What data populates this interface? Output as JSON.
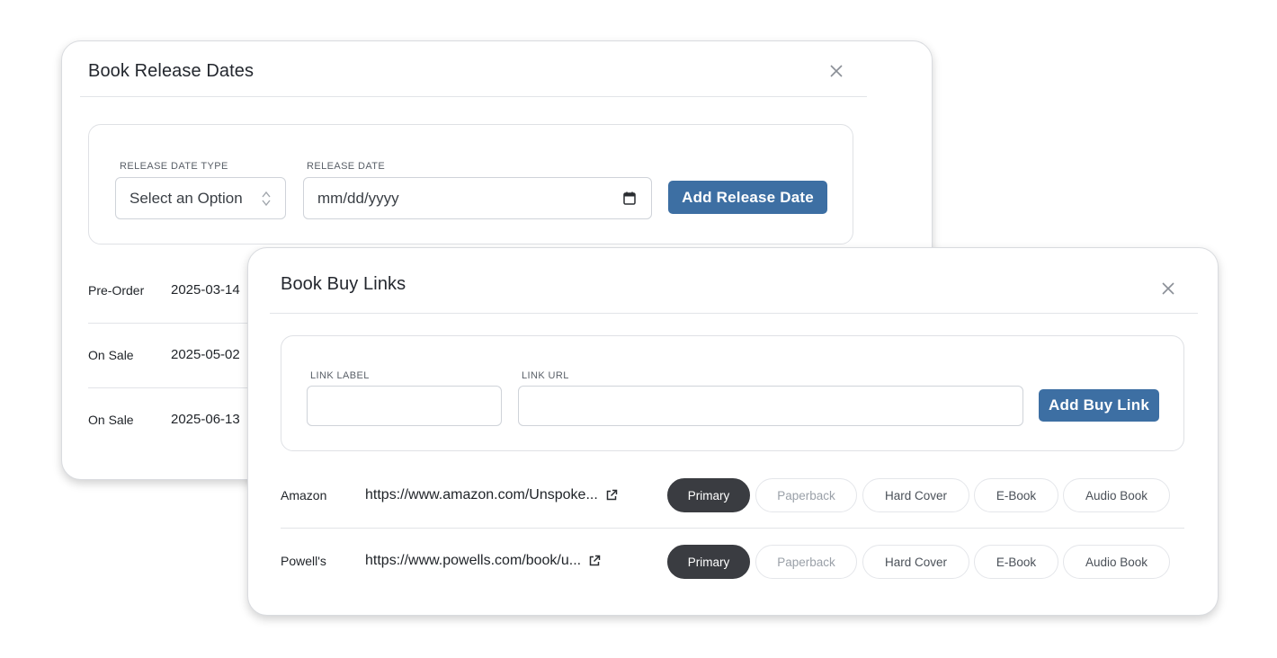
{
  "release_modal": {
    "title": "Book Release Dates",
    "type_label": "RELEASE DATE TYPE",
    "type_value": "Select an Option",
    "date_label": "RELEASE DATE",
    "date_placeholder": "mm/dd/yyyy",
    "add_button": "Add Release Date",
    "rows": [
      {
        "type": "Pre-Order",
        "date": "2025-03-14"
      },
      {
        "type": "On Sale",
        "date": "2025-05-02"
      },
      {
        "type": "On Sale",
        "date": "2025-06-13"
      }
    ]
  },
  "buy_modal": {
    "title": "Book Buy Links",
    "label_label": "LINK LABEL",
    "url_label": "LINK URL",
    "label_value": "",
    "url_value": "",
    "add_button": "Add Buy Link",
    "formats": [
      "Primary",
      "Paperback",
      "Hard Cover",
      "E-Book",
      "Audio Book"
    ],
    "links": [
      {
        "label": "Amazon",
        "url": "https://www.amazon.com/Unspoke...",
        "active_format": "Primary"
      },
      {
        "label": "Powell's",
        "url": "https://www.powells.com/book/u...",
        "active_format": "Primary"
      }
    ]
  },
  "icons": {
    "close": "close-icon",
    "calendar": "calendar-icon",
    "select_arrows": "select-arrows-icon",
    "external_link": "external-link-icon"
  },
  "colors": {
    "accent": "#3d6fa3",
    "pill_active": "#3a3c41"
  }
}
